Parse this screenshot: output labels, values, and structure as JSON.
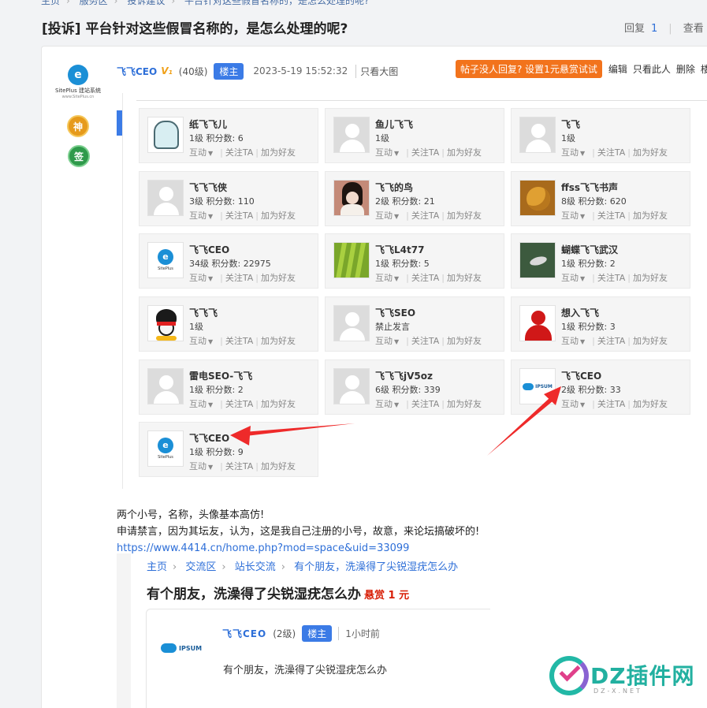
{
  "breadcrumb_top": [
    "主页",
    "服务区",
    "投诉建议",
    "平台针对这些假冒名称的，是怎么处理的呢?"
  ],
  "thread": {
    "title": "[投诉] 平台针对这些假冒名称的，是怎么处理的呢?",
    "reply_label": "回复",
    "reply_count": "1",
    "view_label": "查看"
  },
  "post": {
    "author": "飞飞CEO",
    "vip_badge": "V₁",
    "level": "(40级)",
    "owner_badge": "楼主",
    "time": "2023-5-19 15:52:32",
    "only_image": "只看大图",
    "bounty_button": "帖子没人回复? 设置1元悬赏试试",
    "actions": [
      "编辑",
      "只看此人",
      "删除",
      "楼"
    ],
    "site_logo": {
      "mark": "e",
      "line1": "SitePlus 建站系统",
      "line2": "www.SitePlus.cn"
    },
    "medals": [
      {
        "icon": "shen-medal-icon",
        "text": "神"
      },
      {
        "icon": "qian-medal-icon",
        "text": "签"
      }
    ]
  },
  "user_card_actions": {
    "interact": "互动",
    "follow": "关注TA",
    "friend": "加为好友"
  },
  "users": [
    {
      "name": "纸飞飞儿",
      "info": "1级 积分数: 6",
      "avatar": "ghost"
    },
    {
      "name": "鱼儿飞飞",
      "info": "1级",
      "avatar": "default"
    },
    {
      "name": "飞飞",
      "info": "1级",
      "avatar": "default"
    },
    {
      "name": "飞飞飞侠",
      "info": "3级 积分数: 110",
      "avatar": "default"
    },
    {
      "name": "飞飞的鸟",
      "info": "2级 积分数: 21",
      "avatar": "girl"
    },
    {
      "name": "ffss飞飞书声",
      "info": "8级 积分数: 620",
      "avatar": "flower"
    },
    {
      "name": "飞飞CEO",
      "info": "34级 积分数: 22975",
      "avatar": "logo"
    },
    {
      "name": "飞飞L4t77",
      "info": "1级 积分数: 5",
      "avatar": "grass"
    },
    {
      "name": "蝴蝶飞飞武汉",
      "info": "1级 积分数: 2",
      "avatar": "bird"
    },
    {
      "name": "飞飞飞",
      "info": "1级",
      "avatar": "qq"
    },
    {
      "name": "飞飞SEO",
      "info": "禁止发言",
      "avatar": "default"
    },
    {
      "name": "想入飞飞",
      "info": "1级 积分数: 3",
      "avatar": "red"
    },
    {
      "name": "雷电SEO-飞飞",
      "info": "1级 积分数: 2",
      "avatar": "default"
    },
    {
      "name": "飞飞飞jV5oz",
      "info": "6级 积分数: 339",
      "avatar": "default"
    },
    {
      "name": "飞飞CEO",
      "info": "2级 积分数: 33",
      "avatar": "ipsum"
    },
    {
      "name": "飞飞CEO",
      "info": "1级 积分数: 9",
      "avatar": "logo"
    }
  ],
  "body": {
    "line1": "两个小号，名称，头像基本高仿!",
    "line2": "申请禁言，因为其坛友，认为，这是我自己注册的小号，故意，来论坛搞破坏的!",
    "link": "https://www.4414.cn/home.php?mod=space&uid=33099"
  },
  "embedded": {
    "breadcrumb": [
      "主页",
      "交流区",
      "站长交流",
      "有个朋友，洗澡得了尖锐湿疣怎么办"
    ],
    "title": "有个朋友，洗澡得了尖锐湿疣怎么办",
    "bounty": "悬赏 1 元",
    "author": "飞飞CEO",
    "level": "(2级)",
    "owner_badge": "楼主",
    "time": "1小时前",
    "avatar_text": "IPSUM",
    "content": "有个朋友，洗澡得了尖锐湿疣怎么办"
  },
  "watermark": {
    "brand": "DZ插件网",
    "sub": "DZ-X.NET"
  },
  "colors": {
    "accent": "#3b7be6",
    "link": "#2e6fd8",
    "bounty": "#f2731c",
    "arrow": "#ee2a2a"
  }
}
